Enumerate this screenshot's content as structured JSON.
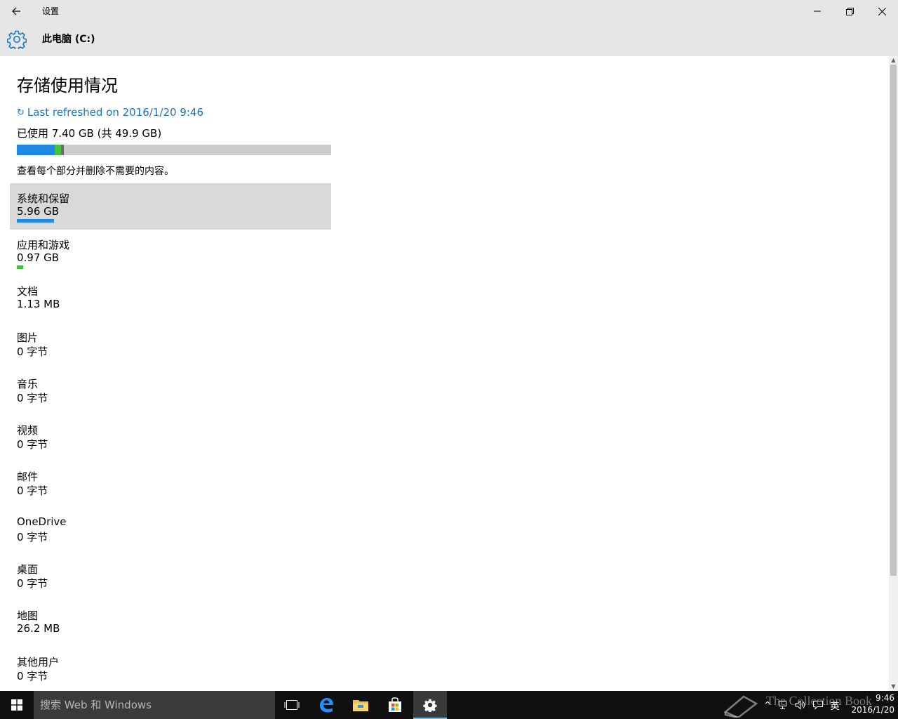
{
  "titlebar": {
    "title": "设置"
  },
  "header": {
    "page_name": "此电脑 (C:)"
  },
  "storage": {
    "heading": "存储使用情况",
    "refresh_text": "Last refreshed on 2016/1/20 9:46",
    "used_text": "已使用 7.40 GB (共 49.9 GB)",
    "used_gb": 7.4,
    "total_gb": 49.9,
    "instructions": "查看每个部分并删除不需要的内容。",
    "colors": {
      "system": "#1e88e5",
      "apps": "#44c144",
      "other": "#6d6d6d",
      "free": "#cccccc",
      "accent": "#1a75c4"
    },
    "categories": [
      {
        "name": "系统和保留",
        "size": "5.96 GB",
        "gb": 5.96,
        "selected": true
      },
      {
        "name": "应用和游戏",
        "size": "0.97 GB",
        "gb": 0.97,
        "selected": false
      },
      {
        "name": "文档",
        "size": "1.13 MB",
        "gb": 0.0011,
        "selected": false
      },
      {
        "name": "图片",
        "size": "0 字节",
        "gb": 0,
        "selected": false
      },
      {
        "name": "音乐",
        "size": "0 字节",
        "gb": 0,
        "selected": false
      },
      {
        "name": "视频",
        "size": "0 字节",
        "gb": 0,
        "selected": false
      },
      {
        "name": "邮件",
        "size": "0 字节",
        "gb": 0,
        "selected": false
      },
      {
        "name": "OneDrive",
        "size": "0 字节",
        "gb": 0,
        "selected": false
      },
      {
        "name": "桌面",
        "size": "0 字节",
        "gb": 0,
        "selected": false
      },
      {
        "name": "地图",
        "size": "26.2 MB",
        "gb": 0.0262,
        "selected": false
      },
      {
        "name": "其他用户",
        "size": "0 字节",
        "gb": 0,
        "selected": false
      }
    ]
  },
  "taskbar": {
    "search_placeholder": "搜索 Web 和 Windows",
    "apps": [
      {
        "icon": "task-view-icon"
      },
      {
        "icon": "edge-icon"
      },
      {
        "icon": "file-explorer-icon"
      },
      {
        "icon": "store-icon"
      },
      {
        "icon": "settings-icon",
        "active": true
      }
    ],
    "ime": "英",
    "time": "9:46",
    "date": "2016/1/20"
  },
  "watermark": {
    "text": "The Collection Book"
  }
}
